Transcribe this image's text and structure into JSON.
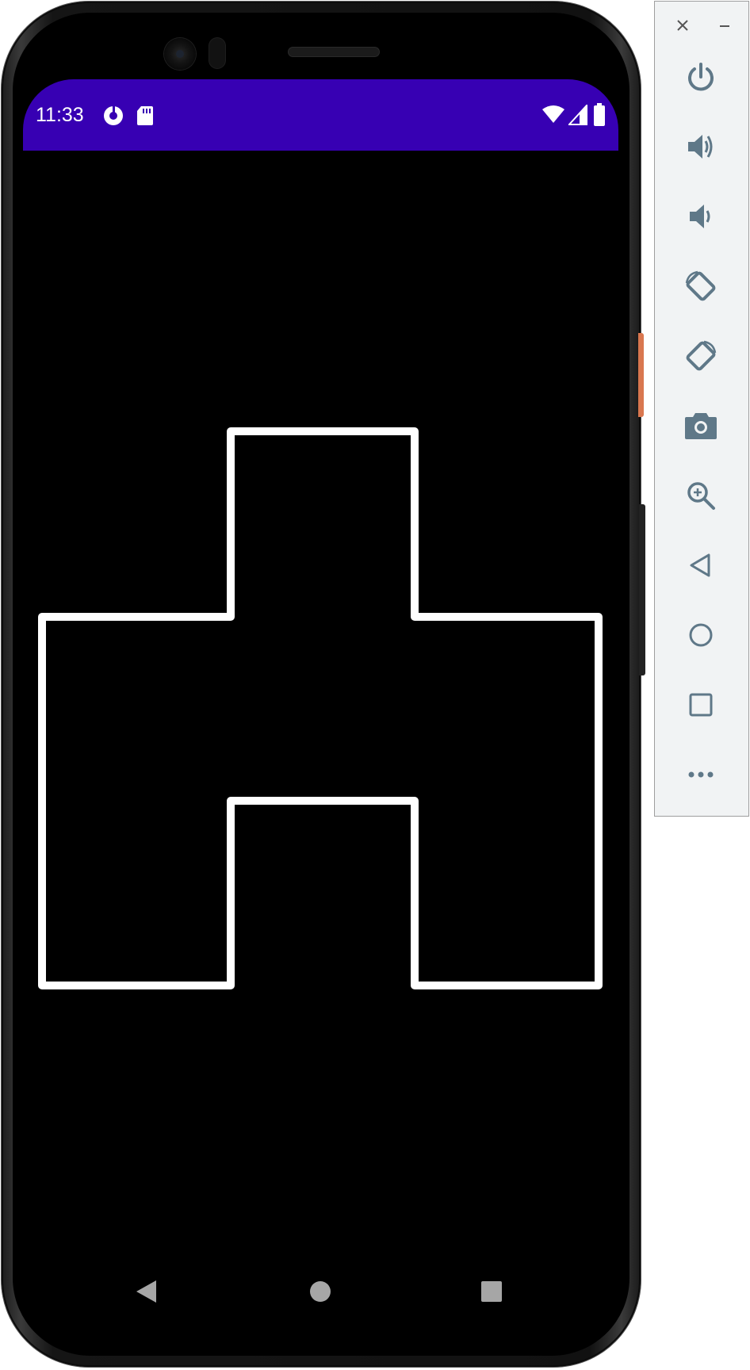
{
  "status_bar": {
    "time": "11:33",
    "left_icons": [
      "data-saver-icon",
      "sd-card-icon"
    ],
    "right_icons": [
      "wifi-icon",
      "cellular-signal-icon",
      "battery-icon"
    ],
    "background_color": "#3700b3"
  },
  "canvas": {
    "background_color": "#000000",
    "stroke_color": "#ffffff",
    "shape": "white-outline-polygon"
  },
  "nav_bar": {
    "buttons": [
      "back-triangle-icon",
      "home-circle-icon",
      "recents-square-icon"
    ]
  },
  "emulator_toolbar": {
    "window_controls": [
      "close-icon",
      "minimize-icon"
    ],
    "buttons": [
      "power-icon",
      "volume-up-icon",
      "volume-down-icon",
      "rotate-left-icon",
      "rotate-right-icon",
      "camera-icon",
      "zoom-icon",
      "back-icon",
      "home-icon",
      "overview-icon",
      "more-icon"
    ],
    "icon_color": "#5f7888"
  }
}
